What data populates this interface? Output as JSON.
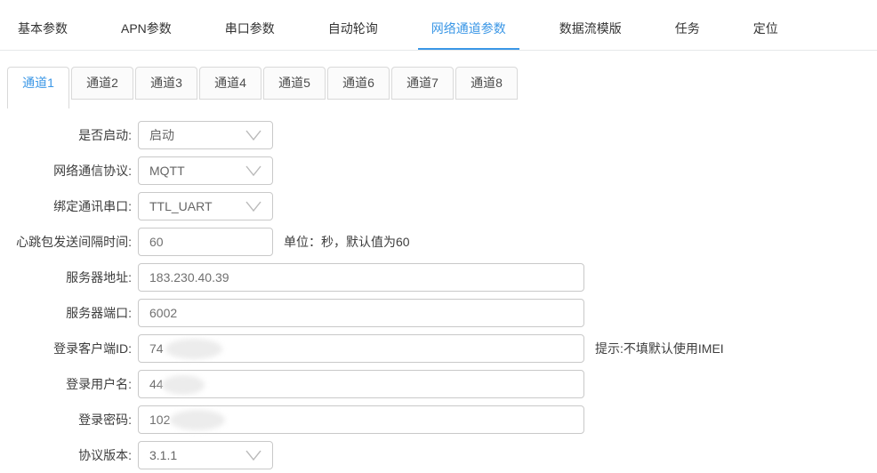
{
  "colors": {
    "accent": "#3b97e6"
  },
  "icons": {
    "select_chevron": "chevron-down"
  },
  "top_tabs": {
    "active_index": 4,
    "items": [
      {
        "label": "基本参数"
      },
      {
        "label": "APN参数"
      },
      {
        "label": "串口参数"
      },
      {
        "label": "自动轮询"
      },
      {
        "label": "网络通道参数"
      },
      {
        "label": "数据流模版"
      },
      {
        "label": "任务"
      },
      {
        "label": "定位"
      }
    ]
  },
  "channel_tabs": {
    "active_index": 0,
    "items": [
      {
        "label": "通道1"
      },
      {
        "label": "通道2"
      },
      {
        "label": "通道3"
      },
      {
        "label": "通道4"
      },
      {
        "label": "通道5"
      },
      {
        "label": "通道6"
      },
      {
        "label": "通道7"
      },
      {
        "label": "通道8"
      }
    ]
  },
  "form": {
    "rows": [
      {
        "label": "是否启动:",
        "type": "select",
        "value": "启动"
      },
      {
        "label": "网络通信协议:",
        "type": "select",
        "value": "MQTT"
      },
      {
        "label": "绑定通讯串口:",
        "type": "select",
        "value": "TTL_UART"
      },
      {
        "label": "心跳包发送间隔时间:",
        "type": "input",
        "value": "60",
        "hint": "单位：秒，默认值为60"
      },
      {
        "label": "服务器地址:",
        "type": "input",
        "value": "183.230.40.39"
      },
      {
        "label": "服务器端口:",
        "type": "input",
        "value": "6002"
      },
      {
        "label": "登录客户端ID:",
        "type": "input",
        "value": "74",
        "hint": "提示:不填默认使用IMEI",
        "redacted": true
      },
      {
        "label": "登录用户名:",
        "type": "input",
        "value": "44",
        "redacted": true
      },
      {
        "label": "登录密码:",
        "type": "input",
        "value": "102",
        "redacted": true
      },
      {
        "label": "协议版本:",
        "type": "select",
        "value": "3.1.1"
      }
    ]
  }
}
